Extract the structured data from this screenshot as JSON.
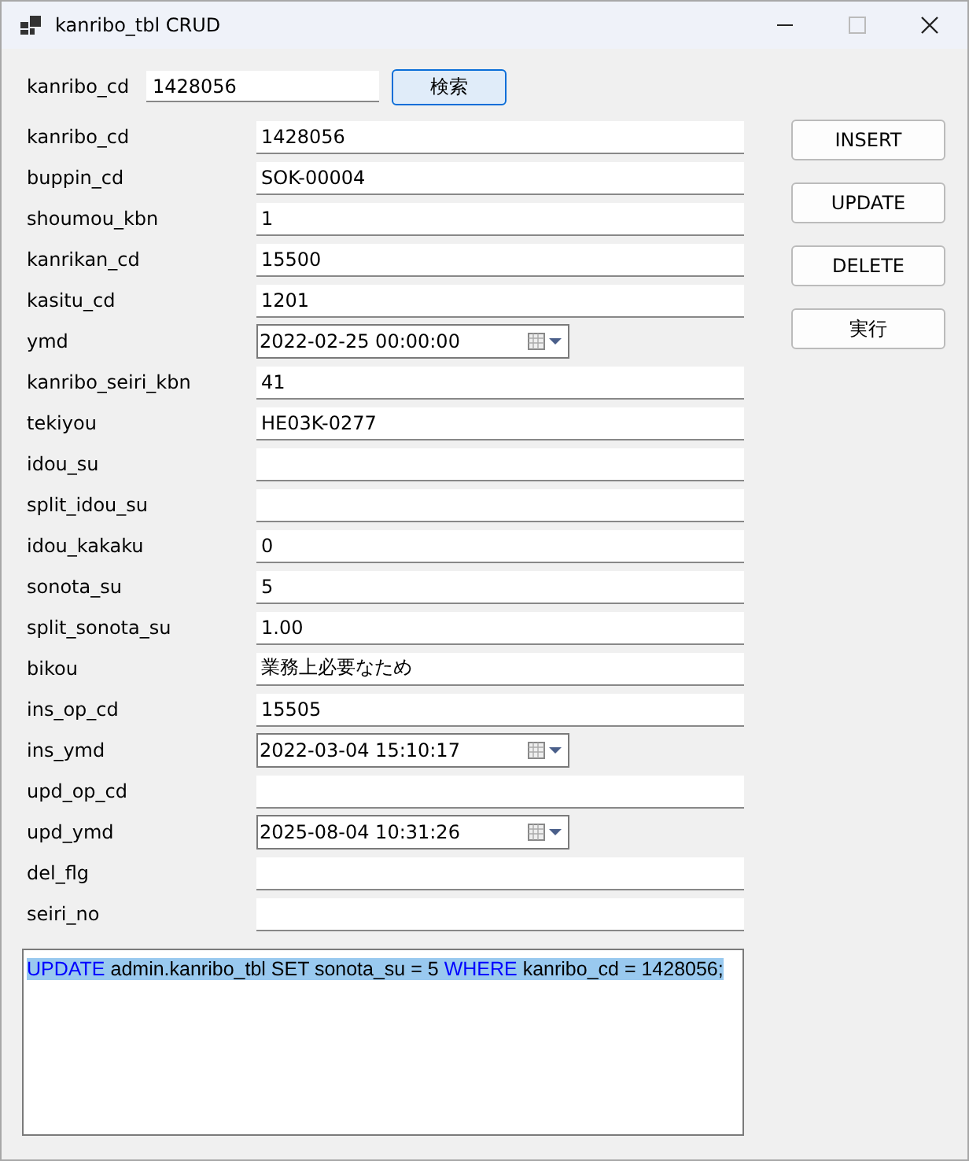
{
  "window": {
    "title": "kanribo_tbl CRUD"
  },
  "search": {
    "label": "kanribo_cd",
    "value": "1428056",
    "button": "検索"
  },
  "fields": [
    {
      "label": "kanribo_cd",
      "kind": "text",
      "value": "1428056"
    },
    {
      "label": "buppin_cd",
      "kind": "text",
      "value": "SOK-00004"
    },
    {
      "label": "shoumou_kbn",
      "kind": "text",
      "value": "1"
    },
    {
      "label": "kanrikan_cd",
      "kind": "text",
      "value": "15500"
    },
    {
      "label": "kasitu_cd",
      "kind": "text",
      "value": "1201"
    },
    {
      "label": "ymd",
      "kind": "date",
      "value": "2022-02-25 00:00:00"
    },
    {
      "label": "kanribo_seiri_kbn",
      "kind": "text",
      "value": "41"
    },
    {
      "label": "tekiyou",
      "kind": "text",
      "value": "HE03K-0277"
    },
    {
      "label": "idou_su",
      "kind": "text"
    },
    {
      "label": "split_idou_su",
      "kind": "text"
    },
    {
      "label": "idou_kakaku",
      "kind": "text",
      "value": "0"
    },
    {
      "label": "sonota_su",
      "kind": "text",
      "value": "5"
    },
    {
      "label": "split_sonota_su",
      "kind": "text",
      "value": "1.00"
    },
    {
      "label": "bikou",
      "kind": "text",
      "value": "業務上必要なため"
    },
    {
      "label": "ins_op_cd",
      "kind": "text",
      "value": "15505"
    },
    {
      "label": "ins_ymd",
      "kind": "date",
      "value": "2022-03-04 15:10:17"
    },
    {
      "label": "upd_op_cd",
      "kind": "text"
    },
    {
      "label": "upd_ymd",
      "kind": "date",
      "value": "2025-08-04 10:31:26"
    },
    {
      "label": "del_flg",
      "kind": "text"
    },
    {
      "label": "seiri_no",
      "kind": "text"
    }
  ],
  "buttons": [
    "INSERT",
    "UPDATE",
    "DELETE",
    "実行"
  ],
  "sql": {
    "selected": true,
    "tokens": [
      {
        "text": "UPDATE",
        "kind": "keyword"
      },
      {
        "text": " admin.kanribo_tbl SET sonota_su = 5 ",
        "kind": "plain"
      },
      {
        "text": "WHERE",
        "kind": "keyword"
      },
      {
        "text": " kanribo_cd = 1428056;",
        "kind": "plain"
      }
    ]
  }
}
